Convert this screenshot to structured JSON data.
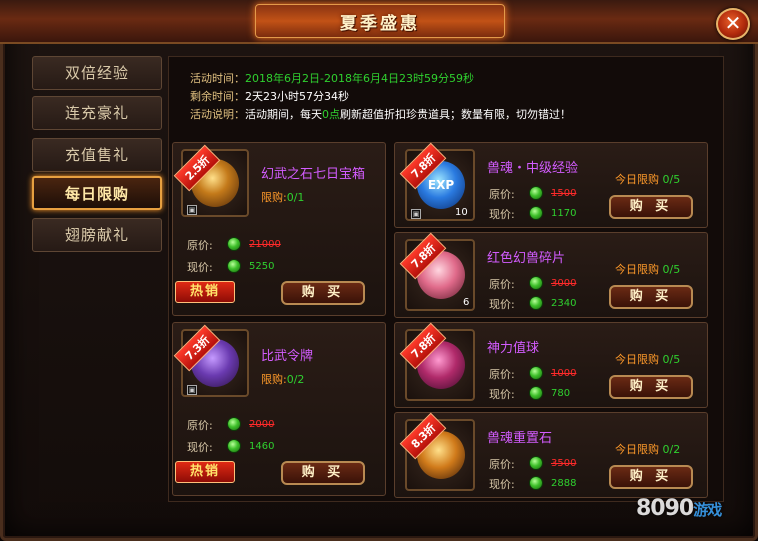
{
  "title": "夏季盛惠",
  "close_label": "✕",
  "sidebar": {
    "items": [
      {
        "label": "双倍经验"
      },
      {
        "label": "连充豪礼"
      },
      {
        "label": "充值售礼"
      },
      {
        "label": "每日限购"
      },
      {
        "label": "翅膀献礼"
      }
    ],
    "active_index": 3
  },
  "info": {
    "time_label": "活动时间：",
    "time_value": "2018年6月2日-2018年6月4日23时59分59秒",
    "remain_label": "剩余时间：",
    "remain_value": "2天23小时57分34秒",
    "desc_label": "活动说明：",
    "desc_pre": "活动期间，每天",
    "desc_hl": "0点",
    "desc_post": "刷新超值折扣珍贵道具；数量有限，切勿错过！"
  },
  "labels": {
    "original": "原价:",
    "current": "现价:",
    "limit": "限购:",
    "today_limit": "今日限购",
    "buy": "购 买",
    "hot": "热销"
  },
  "items": [
    {
      "name": "幻武之石七日宝箱",
      "discount": "2.5折",
      "limit": "0/1",
      "original": "21000",
      "current": "5250",
      "qty": "",
      "hot": true
    },
    {
      "name": "比武令牌",
      "discount": "7.3折",
      "limit": "0/2",
      "original": "2000",
      "current": "1460",
      "qty": "",
      "hot": true
    },
    {
      "name": "兽魂・中级经验",
      "discount": "7.8折",
      "limit": "0/5",
      "original": "1500",
      "current": "1170",
      "qty": "10",
      "art_text": "EXP"
    },
    {
      "name": "红色幻兽碎片",
      "discount": "7.8折",
      "limit": "0/5",
      "original": "3000",
      "current": "2340",
      "qty": "6"
    },
    {
      "name": "神力值球",
      "discount": "7.8折",
      "limit": "0/5",
      "original": "1000",
      "current": "780",
      "qty": ""
    },
    {
      "name": "兽魂重置石",
      "discount": "8.3折",
      "limit": "0/2",
      "original": "3500",
      "current": "2888",
      "qty": ""
    }
  ],
  "watermark": {
    "num": "8090",
    "cn": "游戏"
  },
  "colors": {
    "accent": "#e7a040",
    "price_new": "#2fd02f",
    "price_old": "#ff2a2a",
    "name": "#d35cff"
  }
}
